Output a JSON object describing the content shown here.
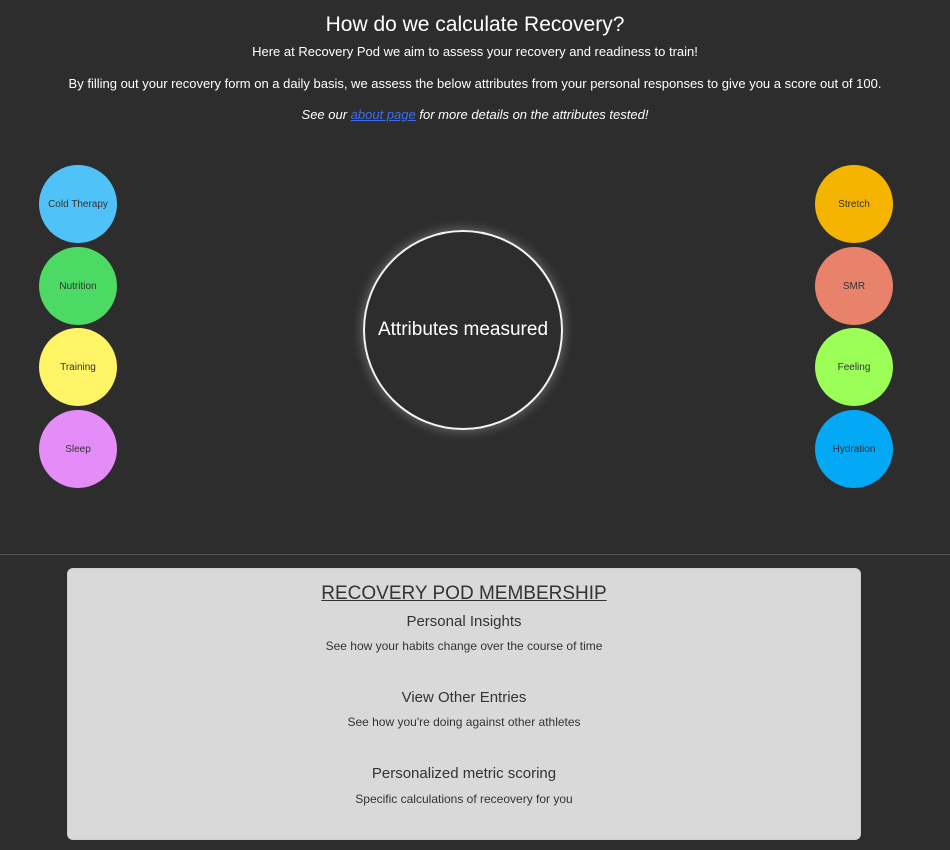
{
  "header": {
    "title": "How do we calculate Recovery?",
    "intro_1": "Here at Recovery Pod we aim to assess your recovery and readiness to train!",
    "intro_2": "By filling out your recovery form on a daily basis, we assess the below attributes from your personal responses to give you a score out of 100.",
    "intro_3_before": "See our ",
    "intro_3_link": "about page",
    "intro_3_after": " for more details on the attributes tested!"
  },
  "attributes": {
    "left": [
      {
        "label": "Cold Therapy",
        "color": "#4fc3f7"
      },
      {
        "label": "Nutrition",
        "color": "#4cd964"
      },
      {
        "label": "Training",
        "color": "#fff366"
      },
      {
        "label": "Sleep",
        "color": "#e48cf8"
      }
    ],
    "right": [
      {
        "label": "Stretch",
        "color": "#f5b400"
      },
      {
        "label": "SMR",
        "color": "#e9826b"
      },
      {
        "label": "Feeling",
        "color": "#9cff57"
      },
      {
        "label": "Hydration",
        "color": "#03a9f4"
      }
    ],
    "center": "Attributes measured"
  },
  "membership": {
    "title": "RECOVERY POD MEMBERSHIP",
    "features": [
      {
        "title": "Personal Insights",
        "desc": "See how your habits change over the course of time"
      },
      {
        "title": "View Other Entries",
        "desc": "See how you're doing against other athletes"
      },
      {
        "title": "Personalized metric scoring",
        "desc": "Specific calculations of receovery for you"
      }
    ]
  }
}
